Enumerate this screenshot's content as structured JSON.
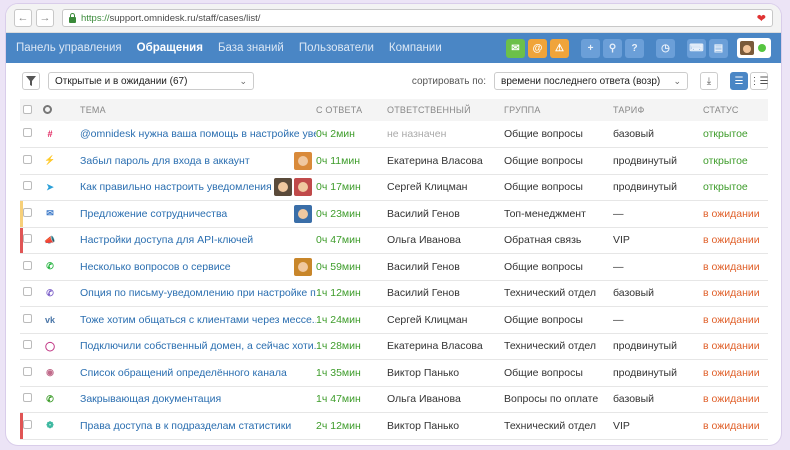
{
  "browser": {
    "scheme": "https://",
    "url": "support.omnidesk.ru/staff/cases/list/"
  },
  "nav": {
    "items": [
      "Панель управления",
      "Обращения",
      "База знаний",
      "Пользователи",
      "Компании"
    ],
    "active_index": 1
  },
  "toolbar_icons": [
    "chat-icon",
    "at-icon",
    "warning-icon",
    "plus-icon",
    "search-icon",
    "help-icon",
    "clock-icon",
    "keyboard-icon",
    "briefcase-icon"
  ],
  "filter": {
    "current": "Открытые и в ожидании (67)",
    "sort_label": "сортировать по:",
    "sort_value": "времени последнего ответа (возр)"
  },
  "table": {
    "headers": {
      "subject": "ТЕМА",
      "since": "С ОТВЕТА",
      "assignee": "ОТВЕТСТВЕННЫЙ",
      "group": "ГРУППА",
      "plan": "ТАРИФ",
      "status": "СТАТУС"
    },
    "rows": [
      {
        "channel": "slack",
        "subject": "@omnidesk нужна ваша помощь в настройке уве...",
        "since": "0ч 2мин",
        "assignee": "не назначен",
        "unassigned": true,
        "group": "Общие вопросы",
        "plan": "базовый",
        "status": "открытое",
        "status_type": "open",
        "mark": "",
        "thumbs": []
      },
      {
        "channel": "messenger",
        "subject": "Забыл пароль для входа в аккаунт",
        "since": "0ч 11мин",
        "assignee": "Екатерина Власова",
        "group": "Общие вопросы",
        "plan": "продвинутый",
        "status": "открытое",
        "status_type": "open",
        "mark": "",
        "thumbs": [
          "#d98a3a"
        ]
      },
      {
        "channel": "telegram",
        "subject": "Как правильно настроить уведомления",
        "since": "0ч 17мин",
        "assignee": "Сергей Клицман",
        "group": "Общие вопросы",
        "plan": "продвинутый",
        "status": "открытое",
        "status_type": "open",
        "mark": "",
        "thumbs": [
          "#5a4a3a",
          "#c04a4a"
        ]
      },
      {
        "channel": "email",
        "subject": "Предложение сотрудничества",
        "since": "0ч 23мин",
        "assignee": "Василий Генов",
        "group": "Топ-менеджмент",
        "plan": "—",
        "status": "в ожидании",
        "status_type": "wait",
        "mark": "#f7d07a",
        "thumbs": [
          "#3a6ea8"
        ]
      },
      {
        "channel": "megaphone",
        "subject": "Настройки доступа для API-ключей",
        "since": "0ч 47мин",
        "assignee": "Ольга Иванова",
        "group": "Обратная связь",
        "plan": "VIP",
        "status": "в ожидании",
        "status_type": "wait",
        "mark": "#e05555",
        "thumbs": []
      },
      {
        "channel": "whatsapp",
        "subject": "Несколько вопросов о сервисе",
        "since": "0ч 59мин",
        "assignee": "Василий Генов",
        "group": "Общие вопросы",
        "plan": "—",
        "status": "в ожидании",
        "status_type": "wait",
        "mark": "",
        "thumbs": [
          "#c8862a"
        ]
      },
      {
        "channel": "viber",
        "subject": "Опция по письму-уведомлению при настройке п...",
        "since": "1ч 12мин",
        "assignee": "Василий Генов",
        "group": "Технический отдел",
        "plan": "базовый",
        "status": "в ожидании",
        "status_type": "wait",
        "mark": "",
        "thumbs": []
      },
      {
        "channel": "vk",
        "subject": "Тоже хотим общаться с клиентами через мессе...",
        "since": "1ч 24мин",
        "assignee": "Сергей Клицман",
        "group": "Общие вопросы",
        "plan": "—",
        "status": "в ожидании",
        "status_type": "wait",
        "mark": "",
        "thumbs": []
      },
      {
        "channel": "instagram",
        "subject": "Подключили собственный домен, а сейчас хоти...",
        "since": "1ч 28мин",
        "assignee": "Екатерина Власова",
        "group": "Технический отдел",
        "plan": "продвинутый",
        "status": "в ожидании",
        "status_type": "wait",
        "mark": "",
        "thumbs": []
      },
      {
        "channel": "chat",
        "subject": "Список обращений определённого канала",
        "since": "1ч 35мин",
        "assignee": "Виктор Панько",
        "group": "Общие вопросы",
        "plan": "продвинутый",
        "status": "в ожидании",
        "status_type": "wait",
        "mark": "",
        "thumbs": []
      },
      {
        "channel": "phone",
        "subject": "Закрывающая документация",
        "since": "1ч 47мин",
        "assignee": "Ольга Иванова",
        "group": "Вопросы по оплате",
        "plan": "базовый",
        "status": "в ожидании",
        "status_type": "wait",
        "mark": "",
        "thumbs": []
      },
      {
        "channel": "bug",
        "subject": "Права доступа в к подразделам статистики",
        "since": "2ч 12мин",
        "assignee": "Виктор Панько",
        "group": "Технический отдел",
        "plan": "VIP",
        "status": "в ожидании",
        "status_type": "wait",
        "mark": "#e05555",
        "thumbs": []
      }
    ]
  },
  "colors": {
    "nav_bg": "#4a86c5",
    "link": "#2a6eb0",
    "open": "#3d9c2a",
    "waiting": "#e0602a"
  }
}
